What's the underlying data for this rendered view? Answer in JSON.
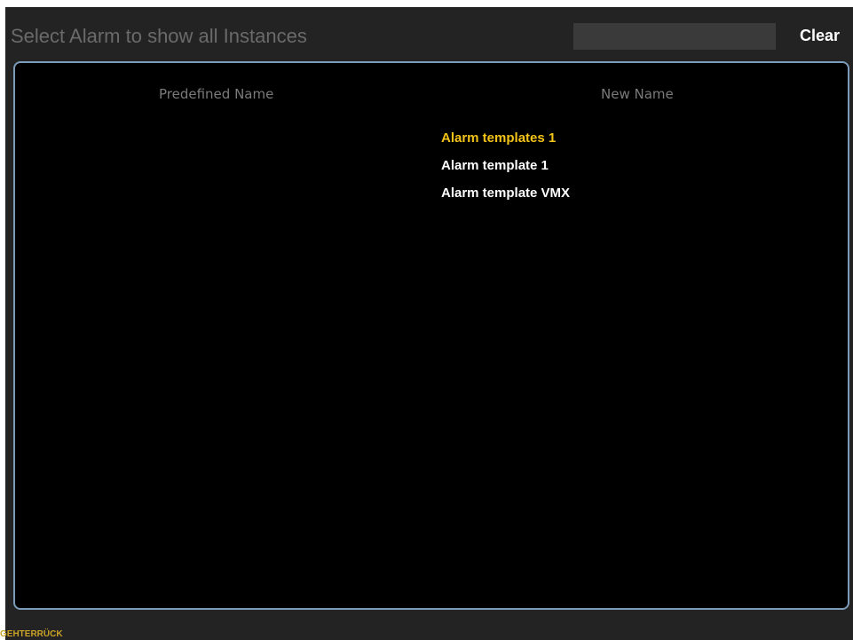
{
  "header": {
    "title": "Select Alarm to show all Instances",
    "search_value": "",
    "clear_label": "Clear"
  },
  "table": {
    "columns": [
      "Predefined Name",
      "New Name"
    ],
    "rows": [
      {
        "predefined": "",
        "new_name": "Alarm templates 1",
        "selected": true
      },
      {
        "predefined": "",
        "new_name": "Alarm template 1",
        "selected": false
      },
      {
        "predefined": "",
        "new_name": "Alarm template VMX",
        "selected": false
      }
    ]
  },
  "footer": {
    "label": "GEHTERRÜCK"
  },
  "colors": {
    "panel_bg": "#232323",
    "list_bg": "#000000",
    "frame_border": "#7b9bb8",
    "selected_text": "#f2c318",
    "normal_text": "#ffffff",
    "footer_text": "#c9a227"
  }
}
